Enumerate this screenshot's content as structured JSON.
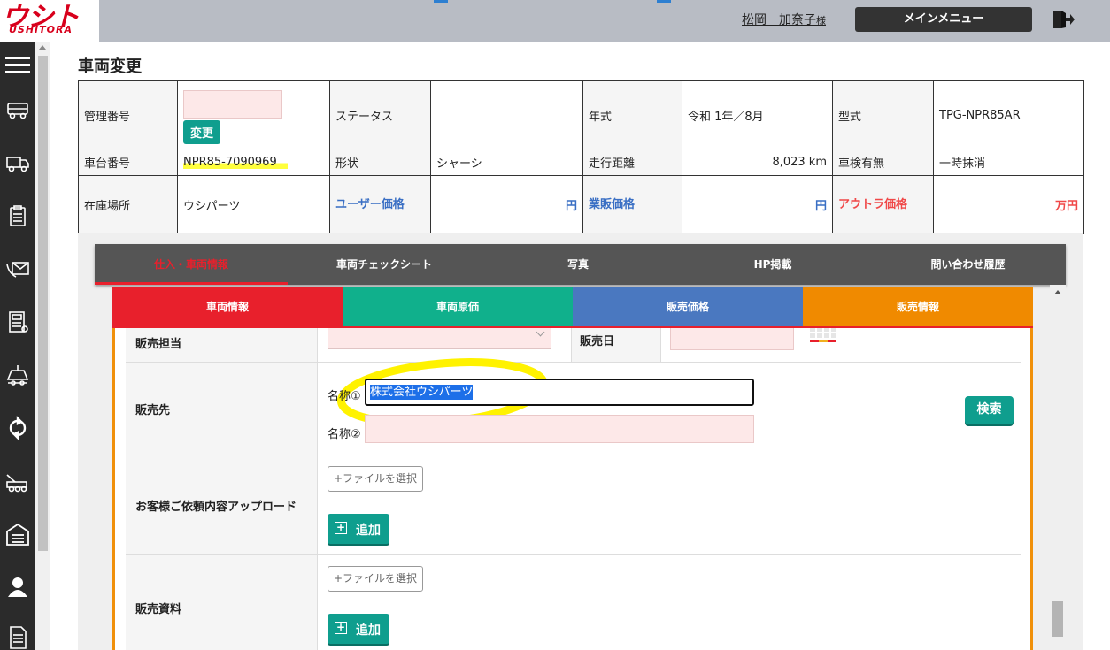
{
  "header": {
    "logo_mark": "ウシトラ",
    "logo_sub": "USHITORA",
    "user_name": "松岡　加奈子",
    "user_suffix": "様",
    "main_menu": "メインメニュー"
  },
  "page": {
    "title": "車両変更"
  },
  "info": {
    "mgmt_label": "管理番号",
    "change_button": "変更",
    "status_label": "ステータス",
    "status_value": "",
    "year_label": "年式",
    "year_value": "令和 1年／8月",
    "model_label": "型式",
    "model_value": "TPG-NPR85AR",
    "chassis_label": "車台番号",
    "chassis_value": "NPR85-7090969",
    "shape_label": "形状",
    "shape_value": "シャーシ",
    "mileage_label": "走行距離",
    "mileage_value": "8,023 km",
    "inspection_label": "車検有無",
    "inspection_value": "一時抹消",
    "location_label": "在庫場所",
    "location_value": "ウシパーツ",
    "user_price_label": "ユーザー価格",
    "user_price_unit": "円",
    "dealer_price_label": "業販価格",
    "dealer_price_unit": "円",
    "outra_price_label": "アウトラ価格",
    "outra_price_unit": "万円"
  },
  "tabs": {
    "main": [
      {
        "label": "仕入・車両情報"
      },
      {
        "label": "車両チェックシート"
      },
      {
        "label": "写真"
      },
      {
        "label": "HP掲載"
      },
      {
        "label": "問い合わせ履歴"
      }
    ],
    "sub": [
      {
        "label": "車両情報",
        "color": "#e8202c"
      },
      {
        "label": "車両原価",
        "color": "#10b08c"
      },
      {
        "label": "販売価格",
        "color": "#4a78c0"
      },
      {
        "label": "販売情報",
        "color": "#f08a00"
      }
    ]
  },
  "form": {
    "sales_rep_label": "販売担当",
    "sales_date_label": "販売日",
    "buyer_label": "販売先",
    "name1_label": "名称①",
    "name1_value": "株式会社ウシパーツ",
    "name2_label": "名称②",
    "search_button": "検索",
    "upload_label": "お客様ご依頼内容アップロード",
    "file_button": "+ファイルを選択",
    "add_button": "追加",
    "sales_docs_label": "販売資料"
  },
  "colors": {
    "accent_teal": "#0f9e8e",
    "header_gray": "#b8bcc4",
    "nav_dark": "#2b2b2b",
    "panel_orange": "#f0900a",
    "highlight_yellow": "#ffff3c"
  },
  "icons": [
    "menu-icon",
    "truck-front-icon",
    "truck-side-icon",
    "clipboard-icon",
    "mail-phone-icon",
    "calculator-icon",
    "tow-icon",
    "refresh-icon",
    "crane-truck-icon",
    "garage-icon",
    "user-icon",
    "document-icon",
    "logout-icon",
    "calendar-icon"
  ]
}
